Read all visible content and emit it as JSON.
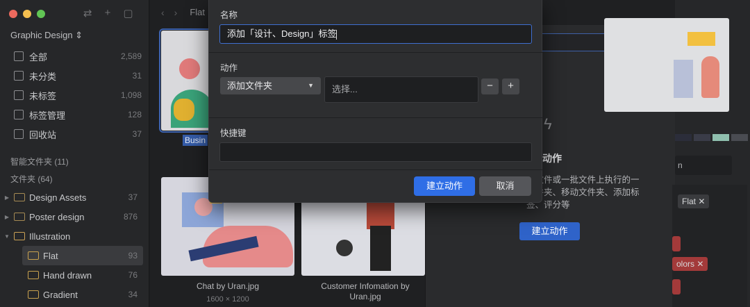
{
  "sidebar": {
    "library": "Graphic Design ⇕",
    "nav": [
      {
        "label": "全部",
        "count": "2,589",
        "icon": "inbox-icon"
      },
      {
        "label": "未分类",
        "count": "31",
        "icon": "unsorted-icon"
      },
      {
        "label": "未标签",
        "count": "1,098",
        "icon": "untagged-icon"
      },
      {
        "label": "标签管理",
        "count": "128",
        "icon": "tag-manager-icon"
      },
      {
        "label": "回收站",
        "count": "37",
        "icon": "trash-icon"
      }
    ],
    "smart_folders": "智能文件夹 (11)",
    "folders_header": "文件夹 (64)",
    "folders": [
      {
        "label": "Design Assets",
        "count": "37"
      },
      {
        "label": "Poster design",
        "count": "876"
      },
      {
        "label": "Illustration",
        "count": ""
      },
      {
        "label": "Flat",
        "count": "93"
      },
      {
        "label": "Hand drawn",
        "count": "76"
      },
      {
        "label": "Gradient",
        "count": "34"
      }
    ]
  },
  "main": {
    "crumb": "Flat",
    "items": [
      {
        "caption": "Busin"
      },
      {
        "caption": "Chat by Uran.jpg",
        "dims": "1600 × 1200"
      },
      {
        "caption": "Customer Infomation by",
        "caption2": "Uran.jpg"
      }
    ]
  },
  "right_panel": {
    "title": "建立动作",
    "desc": "个文件或一批文件上执行的一文件夹、移动文件夹、添加标签、评分等",
    "desc_lines": [
      "个文件或一批文件上执行的一",
      "文件夹、移动文件夹、添加标",
      "签、评分等"
    ],
    "button": "建立动作",
    "plus": "+"
  },
  "inspector": {
    "field": "n",
    "tags": [
      {
        "label": "Flat ✕"
      },
      {
        "label": "olors ✕"
      }
    ],
    "swatches": [
      "#2b2d3a",
      "#3a3c48",
      "#8fbfae",
      "#4a4c52"
    ]
  },
  "dialog": {
    "name_label": "名称",
    "name_value": "添加「设计、Design」标签",
    "action_label": "动作",
    "action_select": "添加文件夹",
    "choose_placeholder": "选择...",
    "minus": "−",
    "plus": "+",
    "shortcut_label": "快捷键",
    "confirm": "建立动作",
    "cancel": "取消"
  }
}
